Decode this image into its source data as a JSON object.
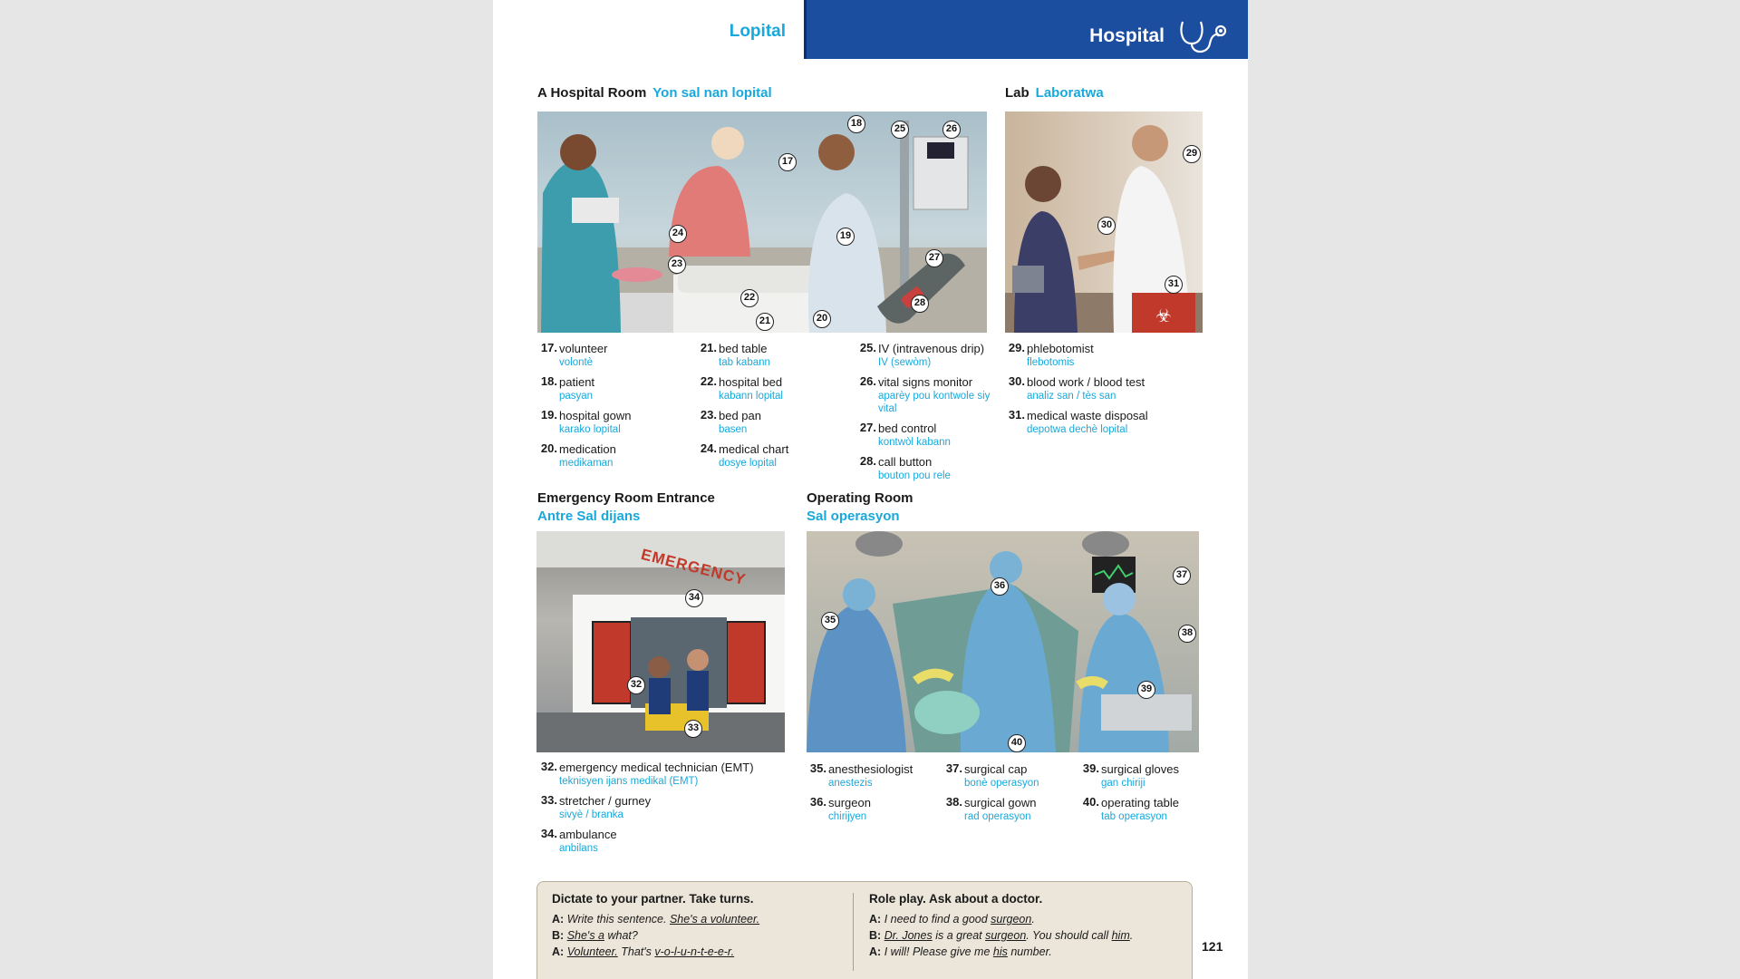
{
  "header": {
    "left_title": "Lopital",
    "right_title": "Hospital"
  },
  "sections": {
    "hospital_room": {
      "en": "A Hospital Room",
      "ht": "Yon sal nan lopital"
    },
    "lab": {
      "en": "Lab",
      "ht": "Laboratwa"
    },
    "er": {
      "en": "Emergency Room Entrance",
      "ht": "Antre Sal dijans"
    },
    "or": {
      "en": "Operating Room",
      "ht": "Sal operasyon"
    }
  },
  "pictures": {
    "emergency_sign": "EMERGENCY"
  },
  "callouts": {
    "hospital_room": [
      "18",
      "17",
      "25",
      "26",
      "19",
      "24",
      "23",
      "27",
      "22",
      "28",
      "21",
      "20"
    ],
    "lab": [
      "29",
      "30",
      "31"
    ],
    "er": [
      "34",
      "32",
      "33"
    ],
    "or": [
      "36",
      "37",
      "35",
      "38",
      "39",
      "40"
    ]
  },
  "words": {
    "room_col1": [
      {
        "n": "17.",
        "en": "volunteer",
        "ht": "volontè"
      },
      {
        "n": "18.",
        "en": "patient",
        "ht": "pasyan"
      },
      {
        "n": "19.",
        "en": "hospital gown",
        "ht": "karako lopital"
      },
      {
        "n": "20.",
        "en": "medication",
        "ht": "medikaman"
      }
    ],
    "room_col2": [
      {
        "n": "21.",
        "en": "bed table",
        "ht": "tab kabann"
      },
      {
        "n": "22.",
        "en": "hospital bed",
        "ht": "kabann lopital"
      },
      {
        "n": "23.",
        "en": "bed pan",
        "ht": "basen"
      },
      {
        "n": "24.",
        "en": "medical chart",
        "ht": "dosye lopital"
      }
    ],
    "room_col3": [
      {
        "n": "25.",
        "en": "IV (intravenous drip)",
        "ht": "IV (sewòm)"
      },
      {
        "n": "26.",
        "en": "vital signs monitor",
        "ht": "aparèy pou kontwole siy vital"
      },
      {
        "n": "27.",
        "en": "bed control",
        "ht": "kontwòl kabann"
      },
      {
        "n": "28.",
        "en": "call button",
        "ht": "bouton pou rele"
      }
    ],
    "lab_col": [
      {
        "n": "29.",
        "en": "phlebotomist",
        "ht": "flebotomis"
      },
      {
        "n": "30.",
        "en": "blood work / blood test",
        "ht": "analiz san / tès san"
      },
      {
        "n": "31.",
        "en": "medical waste disposal",
        "ht": "depotwa dechè lopital"
      }
    ],
    "er_col": [
      {
        "n": "32.",
        "en": "emergency medical technician (EMT)",
        "ht": "teknisyen ijans medikal (EMT)"
      },
      {
        "n": "33.",
        "en": "stretcher / gurney",
        "ht": "sivyè / branka"
      },
      {
        "n": "34.",
        "en": "ambulance",
        "ht": "anbilans"
      }
    ],
    "or_col1": [
      {
        "n": "35.",
        "en": "anesthesiologist",
        "ht": "anestezis"
      },
      {
        "n": "36.",
        "en": "surgeon",
        "ht": "chirijyen"
      }
    ],
    "or_col2": [
      {
        "n": "37.",
        "en": "surgical cap",
        "ht": "bonè operasyon"
      },
      {
        "n": "38.",
        "en": "surgical gown",
        "ht": "rad operasyon"
      }
    ],
    "or_col3": [
      {
        "n": "39.",
        "en": "surgical gloves",
        "ht": "gan chiriji"
      },
      {
        "n": "40.",
        "en": "operating table",
        "ht": "tab operasyon"
      }
    ]
  },
  "dictate": {
    "title": "Dictate to your partner. Take turns.",
    "l1_speaker": "A:",
    "l1_text": "Write this sentence.",
    "l1_u": "She's a volunteer.",
    "l2_speaker": "B:",
    "l2_u": "She's a",
    "l2_text": "what?",
    "l3_speaker": "A:",
    "l3_u": "Volunteer.",
    "l3_text": "That's",
    "l3_u2": "v-o-l-u-n-t-e-e-r."
  },
  "roleplay": {
    "title": "Role play. Ask about a doctor.",
    "l1_speaker": "A:",
    "l1_text": "I need to find a good",
    "l1_u": "surgeon",
    "l1_end": ".",
    "l2_speaker": "B:",
    "l2_u": "Dr. Jones",
    "l2_text": "is a great",
    "l2_u2": "surgeon",
    "l2_text2": ". You should call",
    "l2_u3": "him",
    "l2_end": ".",
    "l3_speaker": "A:",
    "l3_text": "I will! Please give me",
    "l3_u": "his",
    "l3_end": "number."
  },
  "page_number": "121"
}
